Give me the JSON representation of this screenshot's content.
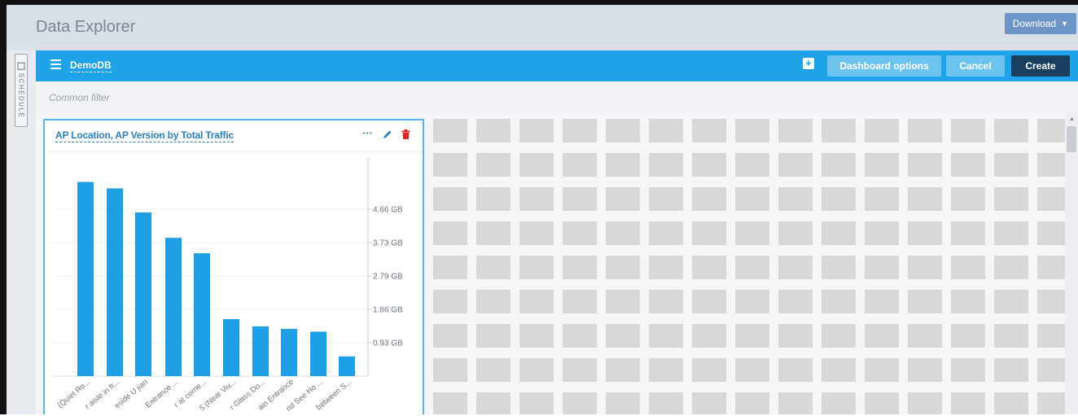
{
  "app": {
    "title": "Data Explorer"
  },
  "header": {
    "download_label": "Download"
  },
  "side_tab": {
    "label": "SCHEDULE"
  },
  "toolbar": {
    "db_name": "DemoDB",
    "dashboard_options_label": "Dashboard options",
    "cancel_label": "Cancel",
    "create_label": "Create"
  },
  "filter": {
    "placeholder": "Common filter"
  },
  "widget": {
    "title": "AP Location, AP Version by Total Traffic"
  },
  "colors": {
    "accent": "#1ea3e8",
    "create_button": "#183f5e",
    "delete_icon": "#e02424",
    "bar": "#1e9fe6"
  },
  "chart_data": {
    "type": "bar",
    "title": "AP Location, AP Version by Total Traffic",
    "categories": [
      "(Quiet Ro...",
      "r aisle in fr...",
      "eside U jian",
      "Entrance ...",
      "r at corne...",
      "5 (Near Viv...",
      "r Glass Do...",
      "ain Entrance",
      "nd See Ho ...",
      "between S..."
    ],
    "values": [
      5.42,
      5.24,
      4.57,
      3.86,
      3.43,
      1.59,
      1.39,
      1.32,
      1.24,
      0.55
    ],
    "unit": "GB",
    "yticks": [
      "4.66 GB",
      "3.73 GB",
      "2.79 GB",
      "1.86 GB",
      "0.93 GB"
    ],
    "ytick_values": [
      4.66,
      3.73,
      2.79,
      1.86,
      0.93
    ],
    "y_axis_side": "right",
    "ylim": [
      0,
      6
    ],
    "grid": true
  }
}
